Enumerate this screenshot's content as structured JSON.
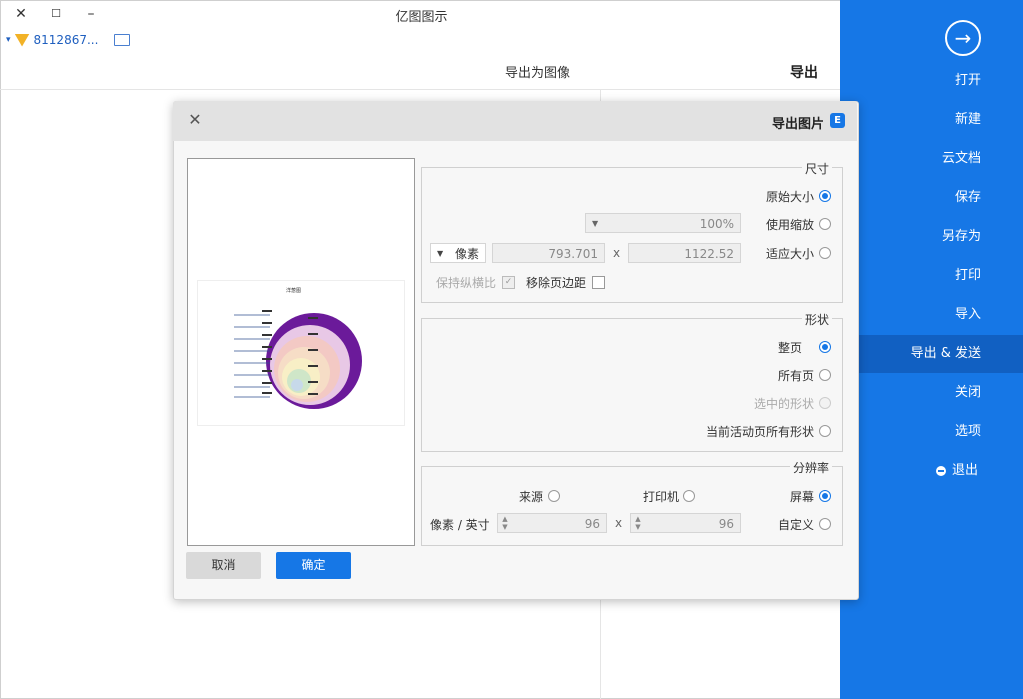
{
  "window": {
    "title": "亿图图示",
    "controls": [
      "✕",
      "☐",
      "–"
    ]
  },
  "account": {
    "id": "8112867...",
    "vip_icon": "vip-badge-icon",
    "notes_icon": "notes-icon"
  },
  "colors": {
    "sidebar": "#1677e6",
    "accent": "#1677e6"
  },
  "sidebar": {
    "back_icon": "arrow-right-circle-icon",
    "items": [
      {
        "label": "打开",
        "active": false
      },
      {
        "label": "新建",
        "active": false
      },
      {
        "label": "云文档",
        "active": false
      },
      {
        "label": "保存",
        "active": false
      },
      {
        "label": "另存为",
        "active": false
      },
      {
        "label": "打印",
        "active": false
      },
      {
        "label": "导入",
        "active": false
      },
      {
        "label": "导出 & 发送",
        "active": true
      },
      {
        "label": "关闭",
        "active": false
      },
      {
        "label": "选项",
        "active": false
      },
      {
        "label": "退出",
        "active": false
      }
    ]
  },
  "main": {
    "section_title": "导出",
    "section_subtitle": "导出为图像"
  },
  "dialog": {
    "title": "导出图片",
    "icon_letter": "E",
    "size_group": {
      "label": "尺寸",
      "options": [
        "原始大小",
        "使用缩放",
        "适应大小"
      ],
      "selected": "原始大小",
      "zoom_value": "100%",
      "width": "1122.52",
      "height": "793.701",
      "x_sep": "x",
      "unit": "像素",
      "remove_margin_label": "移除页边距",
      "keep_ratio_label": "保持纵横比"
    },
    "shape_group": {
      "label": "形状",
      "options": [
        "整页",
        "所有页",
        "选中的形状",
        "当前活动页所有形状"
      ],
      "selected": "整页"
    },
    "resolution_group": {
      "label": "分辨率",
      "options": [
        "屏幕",
        "打印机",
        "来源",
        "自定义"
      ],
      "selected": "屏幕",
      "dpi_x": "96",
      "dpi_y": "96",
      "x_sep": "x",
      "unit": "像素 / 英寸"
    },
    "ok_label": "确定",
    "cancel_label": "取消",
    "preview_title": "洋葱图"
  }
}
